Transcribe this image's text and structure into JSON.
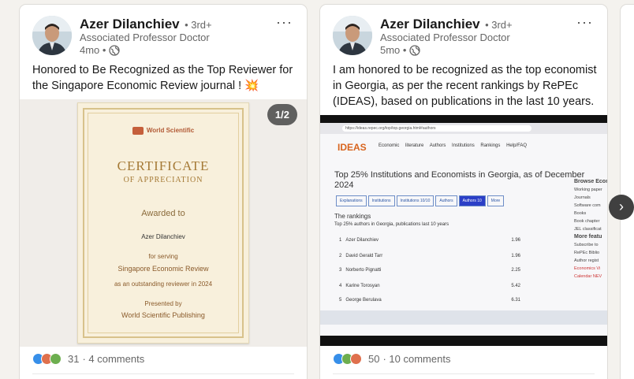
{
  "colors": {
    "background": "#f4f2ee",
    "card": "#ffffff",
    "text_primary": "#191919",
    "text_secondary": "#666666",
    "like_blue": "#378fe9"
  },
  "posts": [
    {
      "author": "Azer Dilanchiev",
      "degree": "• 3rd+",
      "headline": "Associated Professor Doctor",
      "time": "4mo •",
      "visibility_icon": "globe-icon",
      "text": "Honored to Be Recognized as the Top Reviewer for the Singapore Economic Review journal ! 💥",
      "media_counter": "1/2",
      "certificate": {
        "publisher": "World Scientific",
        "title": "CERTIFICATE",
        "subtitle": "OF APPRECIATION",
        "awarded_to_label": "Awarded to",
        "recipient": "Azer Dilanchiev",
        "for_label": "for serving",
        "journal": "Singapore Economic Review",
        "reason": "as an outstanding reviewer in 2024",
        "presented_by_label": "Presented by",
        "presenter": "World Scientific Publishing"
      },
      "reaction_count": "31",
      "comments": "· 4 comments"
    },
    {
      "author": "Azer Dilanchiev",
      "degree": "• 3rd+",
      "headline": "Associated Professor Doctor",
      "time": "5mo •",
      "visibility_icon": "globe-icon",
      "text": "I am honored to be recognized as the top economist in Georgia, as per the recent rankings by RePEc (IDEAS), based on publications in the last 10 years.",
      "screen": {
        "url": "https://ideas.repec.org/top/top.georgia.html#authors",
        "logo": "IDEAS",
        "nav": "Economic literature  Authors  Institutions  Rankings  Help/FAQ",
        "heading": "Top 25% Institutions and Economists in Georgia, as of December 2024",
        "tabs": [
          "Explanations",
          "Institutions",
          "Institutions 10/10",
          "Authors",
          "Authors 10",
          "More"
        ],
        "active_tab": "Authors 10",
        "rankings_title": "The rankings",
        "rankings_subtitle": "Top 25% authors in Georgia, publications last 10 years",
        "rows": [
          {
            "rank": "1",
            "name": "Azer Dilanchiev",
            "score": "1.96"
          },
          {
            "rank": "2",
            "name": "David Gerald Tarr",
            "score": "1.96"
          },
          {
            "rank": "3",
            "name": "Norberto Pignatti",
            "score": "2.25"
          },
          {
            "rank": "4",
            "name": "Karine Torosyan",
            "score": "5.42"
          },
          {
            "rank": "5",
            "name": "George Berulava",
            "score": "6.31"
          }
        ],
        "side_items": [
          "Browse Econ",
          "Working paper",
          "Journals",
          "Software com",
          "Books",
          "Book chapter",
          "JEL classificat",
          "More featu",
          "Subscribe to",
          "RePEc Biblio",
          "Author regist",
          "Economics Vi",
          "Calendar NEV"
        ]
      },
      "reaction_count": "50",
      "comments": "· 10 comments"
    }
  ],
  "carousel": {
    "next_icon": "chevron-right-icon",
    "next_glyph": "›"
  },
  "more_glyph": "···"
}
